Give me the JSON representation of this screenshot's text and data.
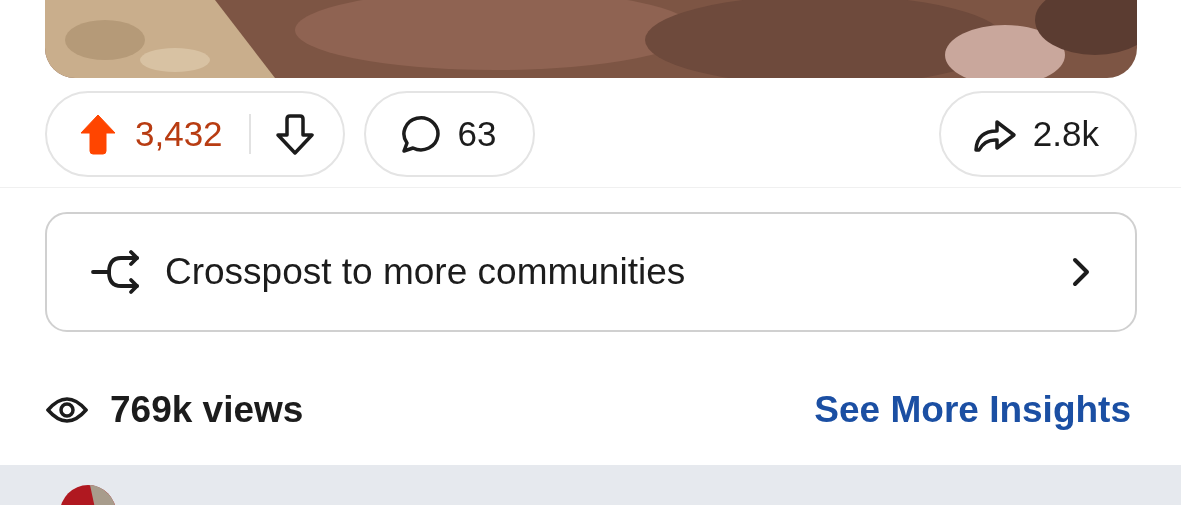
{
  "actions": {
    "score": "3,432",
    "upvoted": true,
    "downvoted": false,
    "comments": "63",
    "shares": "2.8k"
  },
  "crosspost": {
    "label": "Crosspost to more communities"
  },
  "insights": {
    "views": "769k views",
    "link": "See More Insights"
  }
}
